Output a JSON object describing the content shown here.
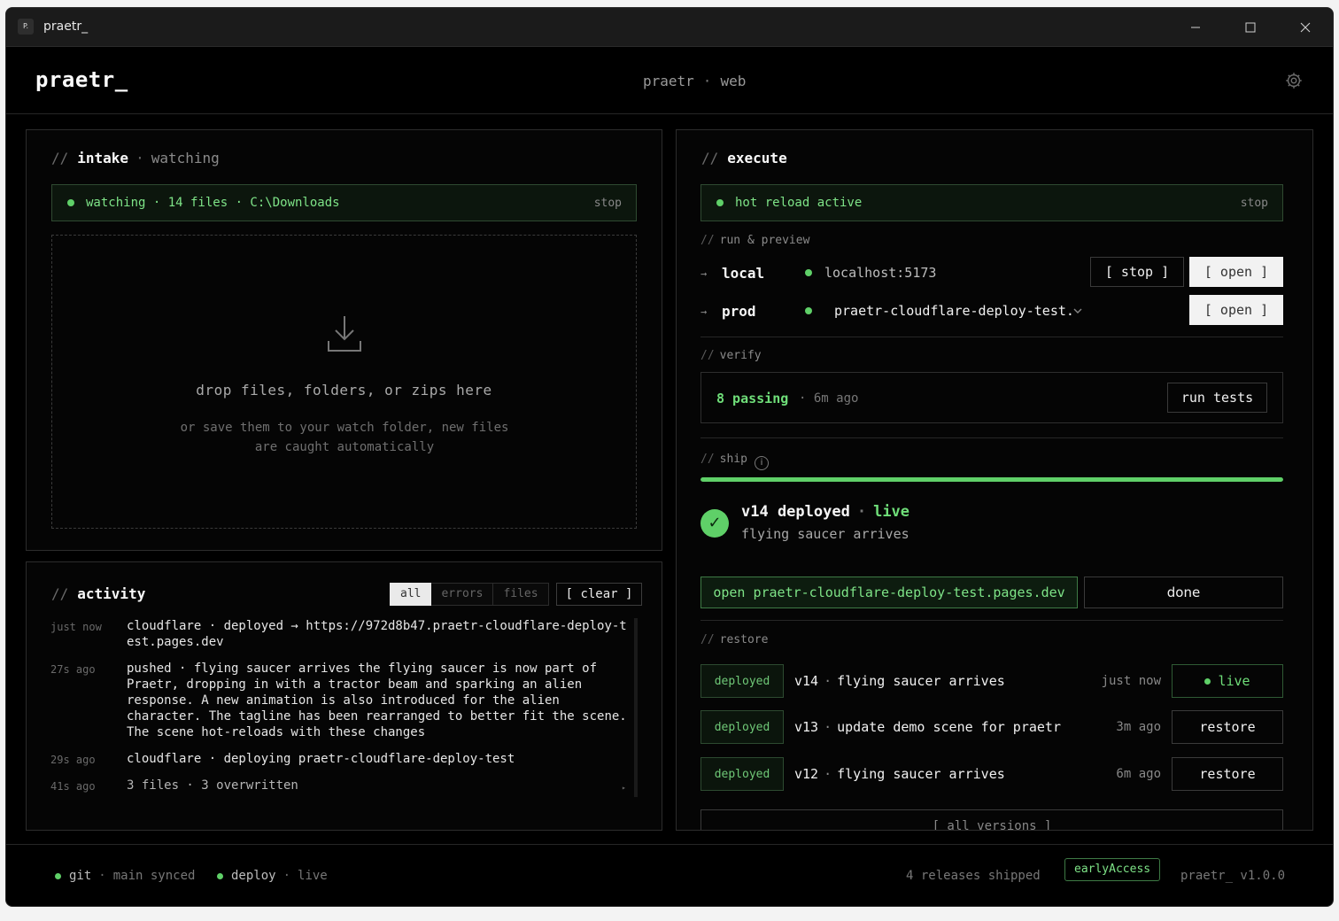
{
  "window": {
    "title": "praetr_",
    "app_icon": "P."
  },
  "header": {
    "logo": "praetr_",
    "center_name": "praetr",
    "center_sep": "·",
    "center_mode": "web"
  },
  "intake": {
    "heading": "intake",
    "heading_prefix": "//",
    "heading_sep": "·",
    "heading_sub": "watching",
    "status": "watching · 14 files · C:\\Downloads",
    "stop_label": "stop",
    "drop_title": "drop files, folders, or zips here",
    "drop_sub": "or save them to your watch folder, new files are caught automatically"
  },
  "activity": {
    "heading": "activity",
    "heading_prefix": "//",
    "filters": [
      "all",
      "errors",
      "files"
    ],
    "active_filter": "all",
    "clear_label": "[ clear ]",
    "entries": [
      {
        "time": "just now",
        "text": "cloudflare · deployed → https://972d8b47.praetr-cloudflare-deploy-test.pages.dev"
      },
      {
        "time": "27s ago",
        "text": "pushed · flying saucer arrives the flying saucer is now part of Praetr, dropping in with a tractor beam and sparking an alien response. A new animation is also introduced for the alien character. The tagline has been rearranged to better fit the scene. The scene hot-reloads with these changes"
      },
      {
        "time": "29s ago",
        "text": "cloudflare · deploying praetr-cloudflare-deploy-test"
      },
      {
        "time": "41s ago",
        "text": "3 files · 3 overwritten"
      }
    ]
  },
  "execute": {
    "heading": "execute",
    "heading_prefix": "//",
    "status": "hot reload active",
    "stop_label": "stop",
    "run_preview_label": "run & preview",
    "section_prefix": "//",
    "arrow": "→",
    "local": {
      "label": "local",
      "url": "localhost:5173",
      "stop_button": "[ stop ]",
      "open_button": "[ open ]"
    },
    "prod": {
      "label": "prod",
      "url": "praetr-cloudflare-deploy-test.",
      "open_button": "[ open ]"
    },
    "verify_label": "verify",
    "verify": {
      "passing": "8 passing",
      "sep": "·",
      "ago": "6m ago",
      "run_button": "run tests"
    },
    "ship_label": "ship",
    "ship_info_icon": "i",
    "ship": {
      "progress": 1.0,
      "check": "✓",
      "version": "v14 deployed",
      "sep": "·",
      "status": "live",
      "message": "flying saucer arrives",
      "open_link": "open praetr-cloudflare-deploy-test.pages.dev",
      "done_button": "done"
    },
    "restore_label": "restore",
    "restore": [
      {
        "badge": "deployed",
        "version": "v14",
        "sep": "·",
        "message": "flying saucer arrives",
        "time": "just now",
        "action": "live"
      },
      {
        "badge": "deployed",
        "version": "v13",
        "sep": "·",
        "message": "update demo scene for praetr",
        "time": "3m ago",
        "action": "restore"
      },
      {
        "badge": "deployed",
        "version": "v12",
        "sep": "·",
        "message": "flying saucer arrives",
        "time": "6m ago",
        "action": "restore"
      }
    ],
    "all_versions": "[ all versions ]"
  },
  "footer": {
    "git_label": "git",
    "git_sep": "·",
    "git_status": "main synced",
    "deploy_label": "deploy",
    "deploy_sep": "·",
    "deploy_status": "live",
    "releases": "4 releases shipped",
    "badge": "earlyAccess",
    "version": "praetr_ v1.0.0"
  },
  "colors": {
    "accent": "#5fd068",
    "background": "#000000",
    "panel_border": "#2c2c2c"
  }
}
